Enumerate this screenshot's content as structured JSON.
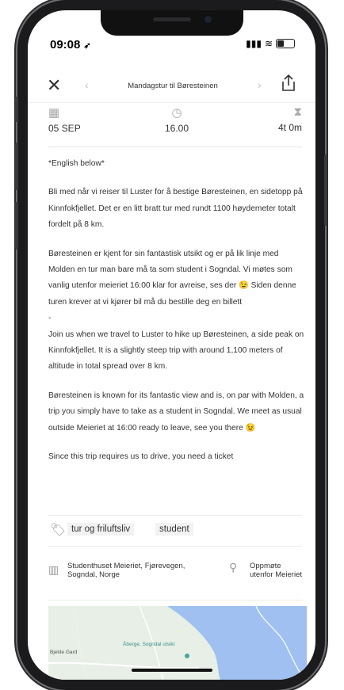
{
  "status": {
    "time": "09:08"
  },
  "nav": {
    "title": "Mandagstur til Børesteinen"
  },
  "meta": {
    "date": "05 SEP",
    "time": "16.00",
    "duration": "4t 0m"
  },
  "content": {
    "paragraphs": [
      "*English below*",
      "Bli med når vi reiser til Luster for å bestige Børesteinen, en sidetopp på Kinnfokfjellet. Det er en litt bratt tur med rundt 1100 høydemeter totalt fordelt på 8 km.",
      "Børesteinen er kjent for sin fantastisk utsikt og er på lik linje med Molden en tur man bare må ta som student i Sogndal. Vi møtes som vanlig utenfor meieriet 16:00 klar for avreise, ses der 😉 Siden denne turen krever at vi kjører bil må du bestille deg en billett",
      "-",
      "Join us when we travel to Luster to hike up Børesteinen, a side peak on Kinnfokfjellet. It is a slightly steep trip with around 1,100 meters of altitude in total spread over 8 km.",
      "Børesteinen is known for its fantastic view and is, on par with Molden, a trip you simply have to take as a student in Sogndal. We meet as usual outside Meieriet at 16:00 ready to leave, see you there 😉",
      "Since this trip requires us to drive, you need a ticket"
    ]
  },
  "tags": [
    "tur og friluftsliv",
    "student"
  ],
  "location": {
    "venue": "Studenthuset Meieriet, Fjørevegen, Sogndal, Norge",
    "meetup": "Oppmøte utenfor Meieriet"
  },
  "map": {
    "labels": [
      "Bjelde Gard",
      "Åberge, Sogndal utsikt"
    ]
  },
  "colors": {
    "map_land": "#e7efe6",
    "map_water": "#9fc0f0",
    "map_road": "#ffffff"
  }
}
